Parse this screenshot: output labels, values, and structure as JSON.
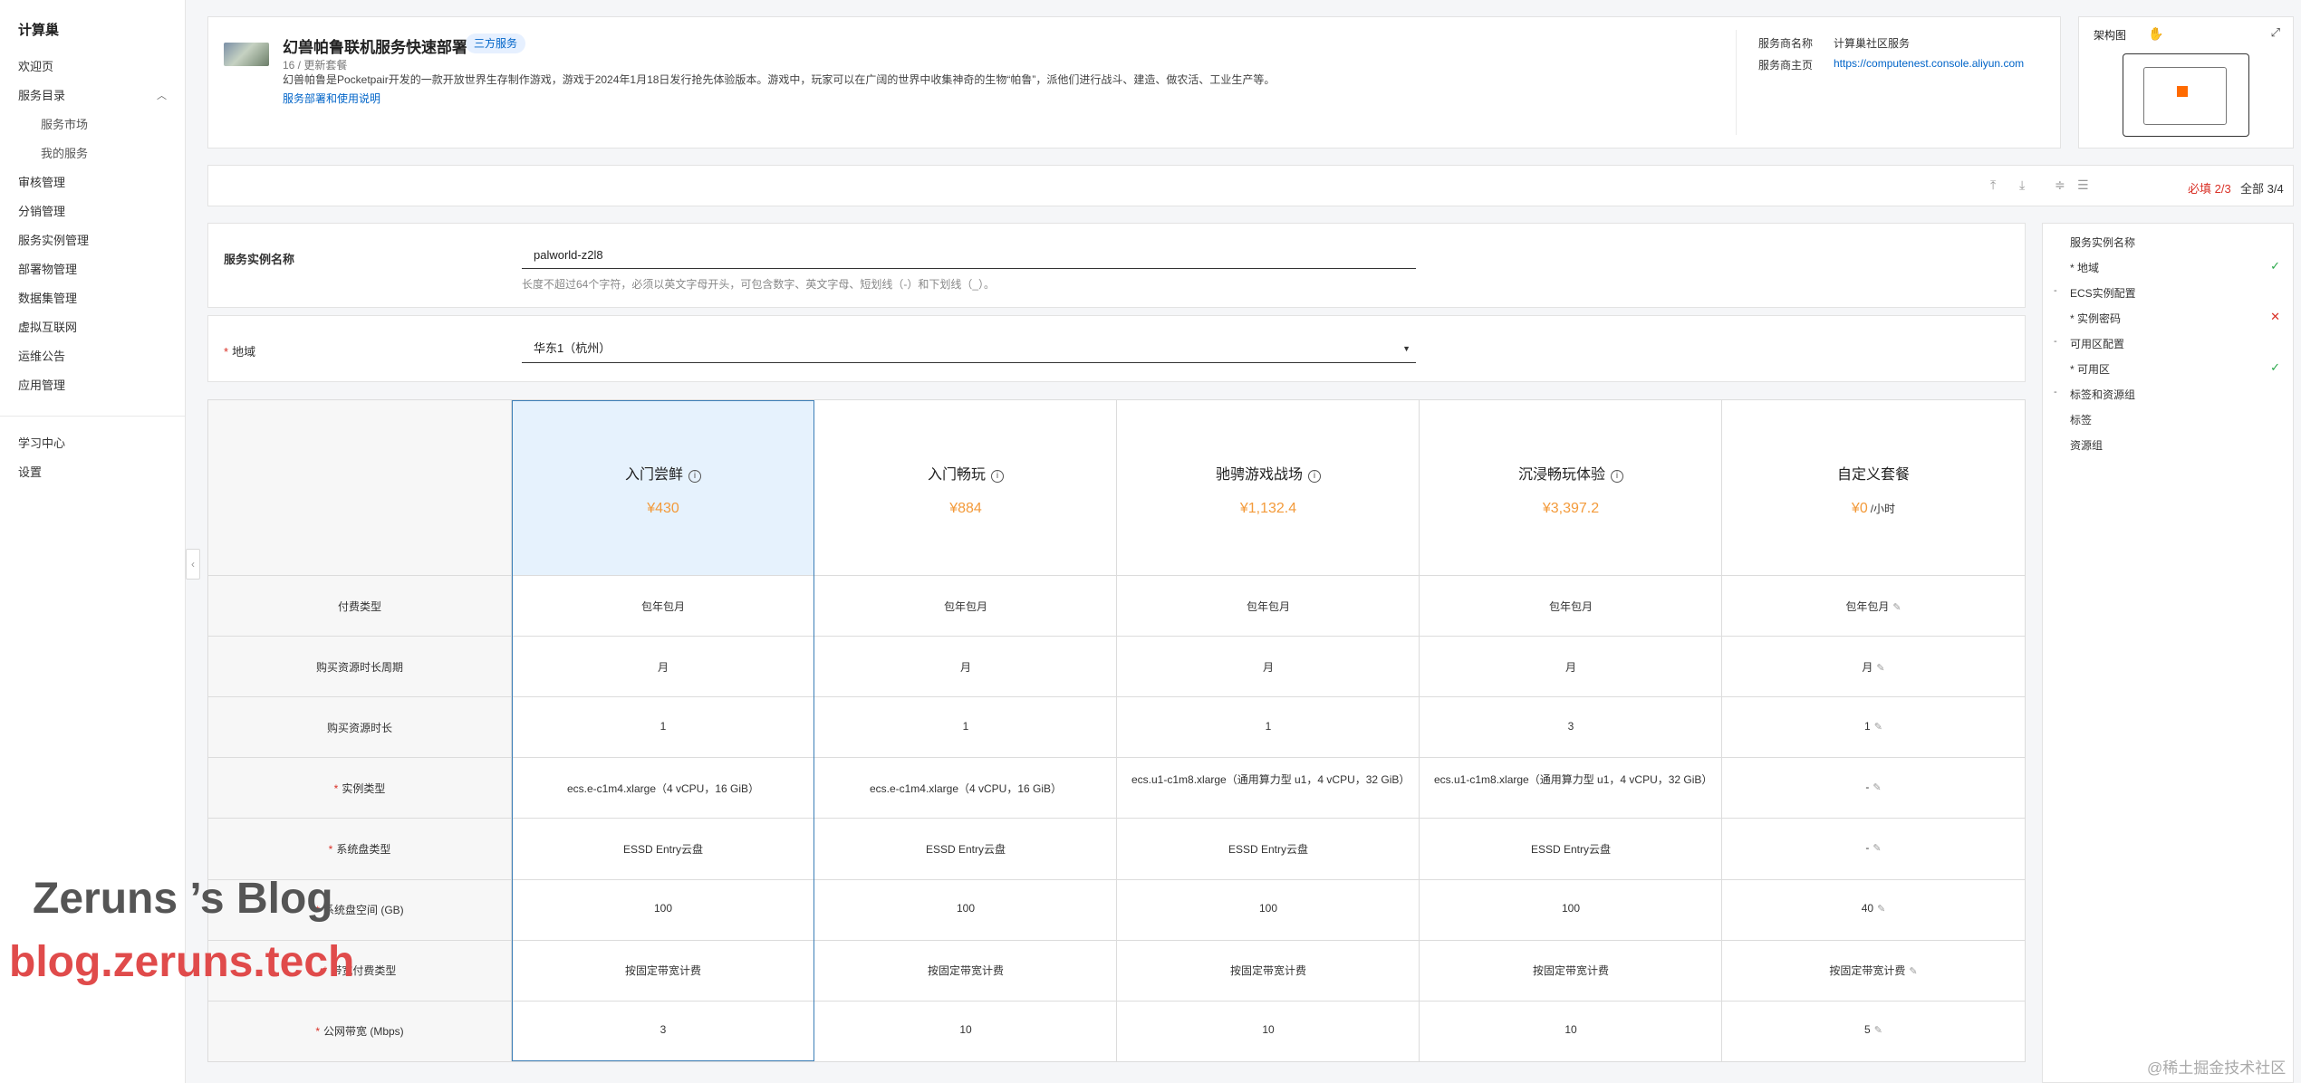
{
  "sidebar": {
    "brand": "计算巢",
    "items": [
      {
        "label": "欢迎页"
      },
      {
        "label": "服务目录"
      },
      {
        "label": "服务市场"
      },
      {
        "label": "我的服务"
      },
      {
        "label": "审核管理"
      },
      {
        "label": "分销管理"
      },
      {
        "label": "服务实例管理"
      },
      {
        "label": "部署物管理"
      },
      {
        "label": "数据集管理"
      },
      {
        "label": "虚拟互联网"
      },
      {
        "label": "运维公告"
      },
      {
        "label": "应用管理"
      }
    ],
    "footer": [
      {
        "label": "学习中心"
      },
      {
        "label": "设置"
      }
    ]
  },
  "service": {
    "title": "幻兽帕鲁联机服务快速部署",
    "badge": "三方服务",
    "version": "16 / 更新套餐",
    "description": "幻兽帕鲁是Pocketpair开发的一款开放世界生存制作游戏，游戏于2024年1月18日发行抢先体验版本。游戏中，玩家可以在广阔的世界中收集神奇的生物“帕鲁”，派他们进行战斗、建造、做农活、工业生产等。",
    "docs_link": "服务部署和使用说明",
    "provider_label": "服务商名称",
    "provider_value": "计算巢社区服务",
    "homepage_label": "服务商主页",
    "homepage_value": "https://computenest.console.aliyun.com"
  },
  "architecture": {
    "title": "架构图"
  },
  "toolbar": {
    "required_label": "必填",
    "required_count": "2/3",
    "all_label": "全部",
    "all_count": "3/4"
  },
  "form": {
    "name_label": "服务实例名称",
    "name_value": "palworld-z2l8",
    "name_hint": "长度不超过64个字符，必须以英文字母开头，可包含数字、英文字母、短划线（-）和下划线（_）。",
    "region_label": "地域",
    "region_value": "华东1（杭州）"
  },
  "plans": {
    "headers": [
      {
        "name": "入门尝鲜",
        "price": "¥430",
        "unit": ""
      },
      {
        "name": "入门畅玩",
        "price": "¥884",
        "unit": ""
      },
      {
        "name": "驰骋游戏战场",
        "price": "¥1,132.4",
        "unit": ""
      },
      {
        "name": "沉浸畅玩体验",
        "price": "¥3,397.2",
        "unit": ""
      },
      {
        "name": "自定义套餐",
        "price": "¥0",
        "unit": "/小时"
      }
    ],
    "rows": [
      {
        "label": "付费类型",
        "required": false,
        "values": [
          "包年包月",
          "包年包月",
          "包年包月",
          "包年包月",
          "包年包月"
        ]
      },
      {
        "label": "购买资源时长周期",
        "required": false,
        "values": [
          "月",
          "月",
          "月",
          "月",
          "月"
        ]
      },
      {
        "label": "购买资源时长",
        "required": false,
        "values": [
          "1",
          "1",
          "1",
          "3",
          "1"
        ]
      },
      {
        "label": "实例类型",
        "required": true,
        "values": [
          "ecs.e-c1m4.xlarge（4 vCPU，16 GiB）",
          "ecs.e-c1m4.xlarge（4 vCPU，16 GiB）",
          "ecs.u1-c1m8.xlarge（通用算力型 u1，4 vCPU，32 GiB）",
          "ecs.u1-c1m8.xlarge（通用算力型 u1，4 vCPU，32 GiB）",
          "-"
        ]
      },
      {
        "label": "系统盘类型",
        "required": true,
        "values": [
          "ESSD Entry云盘",
          "ESSD Entry云盘",
          "ESSD Entry云盘",
          "ESSD Entry云盘",
          "-"
        ]
      },
      {
        "label": "系统盘空间 (GB)",
        "required": true,
        "values": [
          "100",
          "100",
          "100",
          "100",
          "40"
        ]
      },
      {
        "label": "带宽付费类型",
        "required": true,
        "values": [
          "按固定带宽计费",
          "按固定带宽计费",
          "按固定带宽计费",
          "按固定带宽计费",
          "按固定带宽计费"
        ]
      },
      {
        "label": "公网带宽 (Mbps)",
        "required": true,
        "values": [
          "3",
          "10",
          "10",
          "10",
          "5"
        ]
      }
    ]
  },
  "right_nav": [
    {
      "label": "服务实例名称",
      "bullet": "",
      "status": ""
    },
    {
      "label": "* 地域",
      "bullet": "",
      "status": "✓"
    },
    {
      "label": "ECS实例配置",
      "bullet": "-",
      "status": ""
    },
    {
      "label": "* 实例密码",
      "bullet": "",
      "status": "✕"
    },
    {
      "label": "可用区配置",
      "bullet": "-",
      "status": ""
    },
    {
      "label": "* 可用区",
      "bullet": "",
      "status": "✓"
    },
    {
      "label": "标签和资源组",
      "bullet": "-",
      "status": ""
    },
    {
      "label": "标签",
      "bullet": "",
      "status": ""
    },
    {
      "label": "资源组",
      "bullet": "",
      "status": ""
    }
  ],
  "watermarks": {
    "blog": "Zeruns ’s Blog",
    "url": "blog.zeruns.tech",
    "juejin": "@稀土掘金技术社区"
  }
}
